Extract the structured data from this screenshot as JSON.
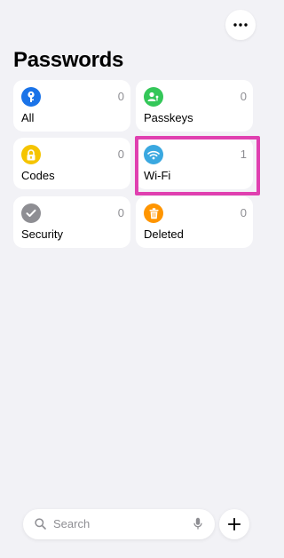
{
  "header": {
    "title": "Passwords",
    "more_icon": "ellipsis-icon"
  },
  "categories": [
    {
      "label": "All",
      "count": "0",
      "icon": "key-icon",
      "color": "#1a73e8"
    },
    {
      "label": "Passkeys",
      "count": "0",
      "icon": "person-badge-icon",
      "color": "#34c759"
    },
    {
      "label": "Codes",
      "count": "0",
      "icon": "lock-code-icon",
      "color": "#f5c400"
    },
    {
      "label": "Wi-Fi",
      "count": "1",
      "icon": "wifi-icon",
      "color": "#3aa8e0",
      "highlighted": true
    },
    {
      "label": "Security",
      "count": "0",
      "icon": "checkmark-icon",
      "color": "#8e8e93"
    },
    {
      "label": "Deleted",
      "count": "0",
      "icon": "trash-icon",
      "color": "#ff9500"
    }
  ],
  "highlight_color": "#e040b0",
  "search": {
    "placeholder": "Search",
    "icon": "search-icon",
    "mic_icon": "microphone-icon"
  },
  "add_button": {
    "icon": "plus-icon"
  }
}
